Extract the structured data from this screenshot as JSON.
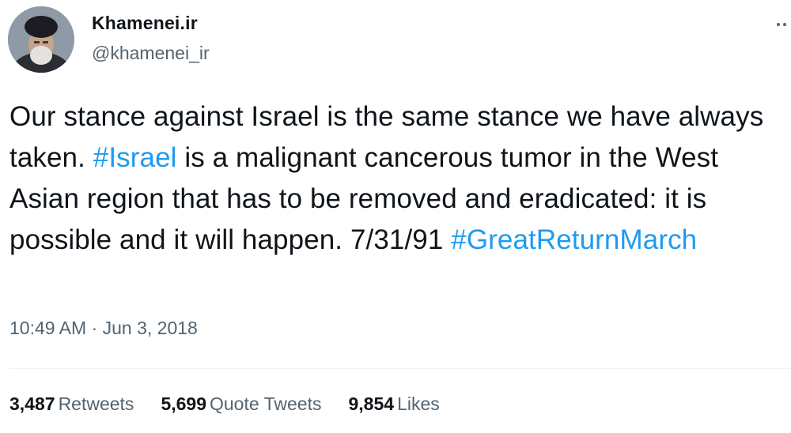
{
  "user": {
    "display_name": "Khamenei.ir",
    "handle": "@khamenei_ir"
  },
  "tweet": {
    "text_1": "Our stance against Israel is the same stance we have always taken. ",
    "hashtag_1": "#Israel",
    "text_2": " is a malignant cancerous tumor in the West Asian region that has to be removed and eradicated: it is possible and it will happen. 7/31/91 ",
    "hashtag_2": "#GreatReturnMarch",
    "timestamp": "10:49 AM · Jun 3, 2018"
  },
  "stats": {
    "retweets_count": "3,487",
    "retweets_label": "Retweets",
    "quotes_count": "5,699",
    "quotes_label": "Quote Tweets",
    "likes_count": "9,854",
    "likes_label": "Likes"
  },
  "colors": {
    "hashtag": "#1d9bf0",
    "secondary_text": "#536471",
    "primary_text": "#0f1419"
  },
  "icons": {
    "more": "more-icon"
  }
}
